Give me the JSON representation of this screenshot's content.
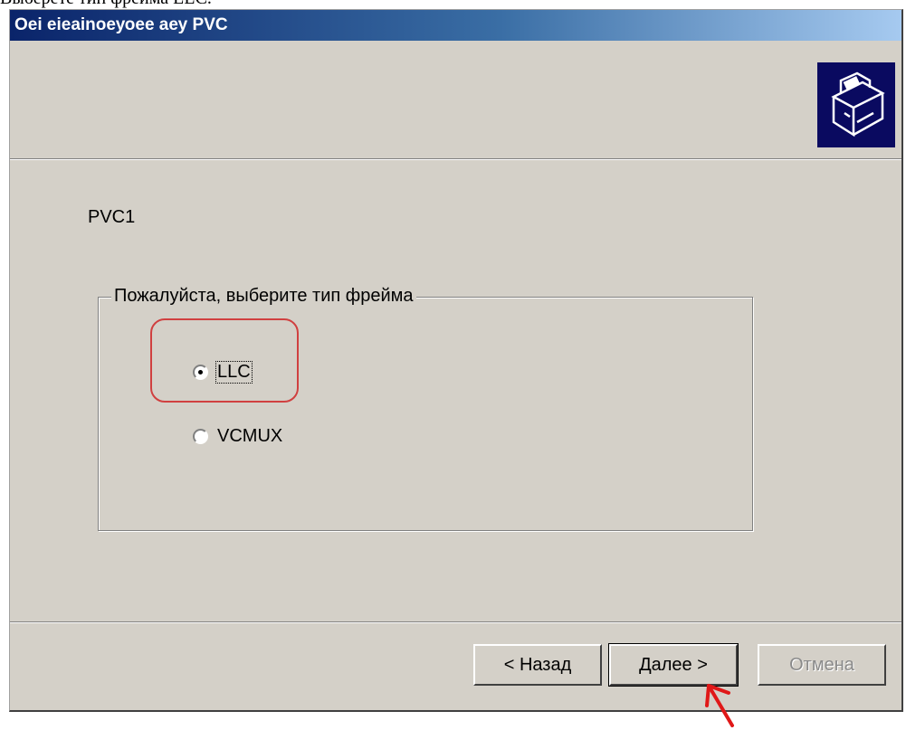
{
  "caption": "Выберете тип фрейма LLC.",
  "window": {
    "title": "Оеі еіеаіnоеуоее аеу PVC"
  },
  "wizard": {
    "pvc_name": "PVC1",
    "group_label": "Пожалуйста, выберите тип фрейма",
    "options": [
      {
        "label": "LLC",
        "selected": true
      },
      {
        "label": "VCMUX",
        "selected": false
      }
    ]
  },
  "buttons": {
    "back": "< Назад",
    "next": "Далее >",
    "cancel": "Отмена"
  },
  "colors": {
    "annotation": "#d04040",
    "title_bar": "#0a246a",
    "dialog_face": "#d4d0c8"
  }
}
